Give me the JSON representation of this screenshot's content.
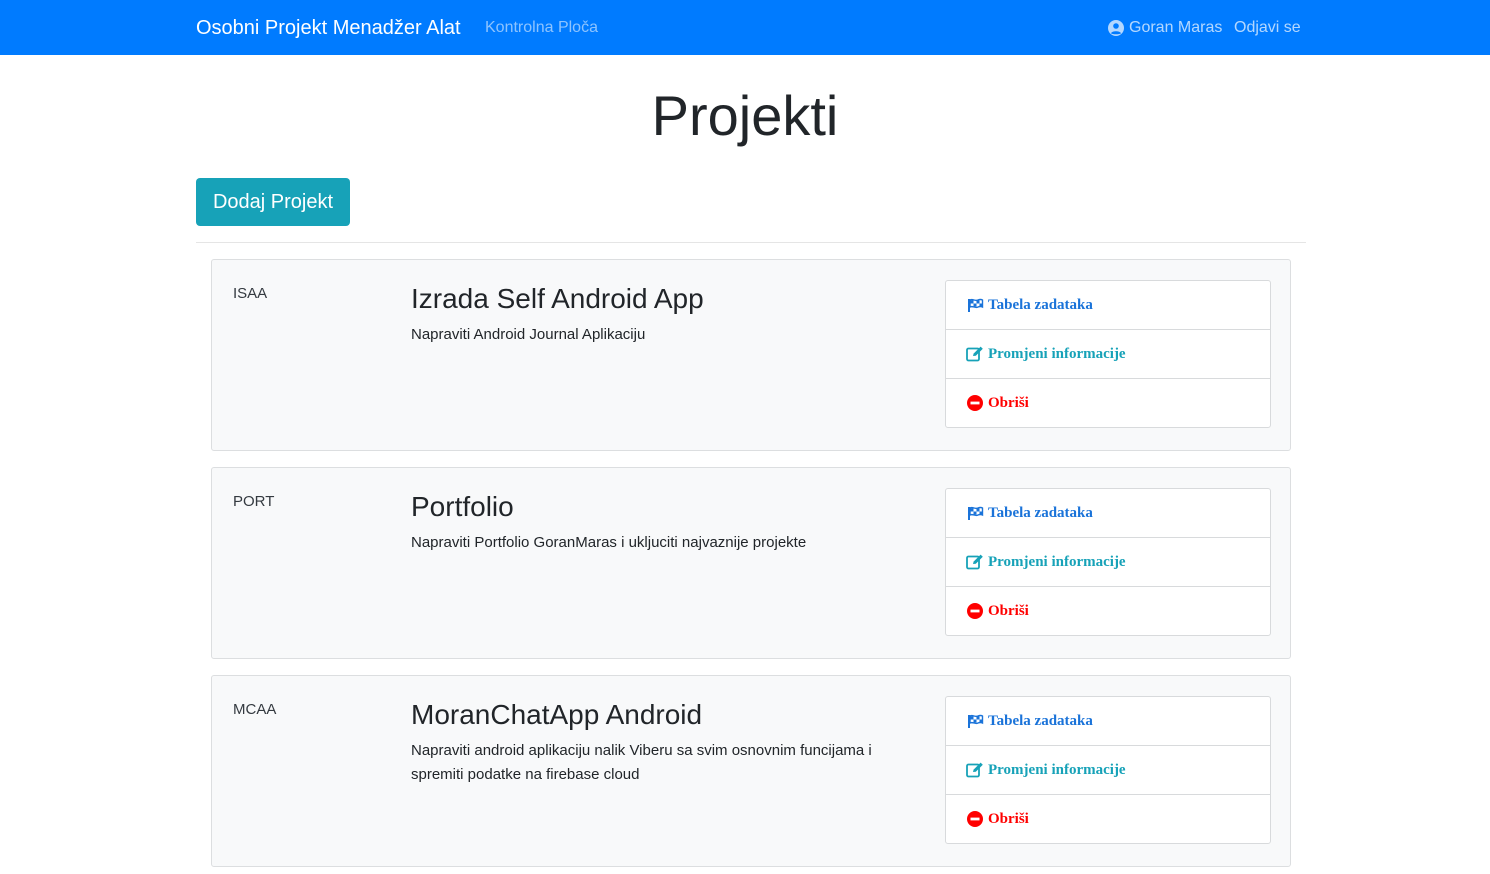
{
  "navbar": {
    "brand": "Osobni Projekt Menadžer Alat",
    "dashboard_link": "Kontrolna Ploča",
    "user_name": "Goran Maras",
    "logout_link": "Odjavi se"
  },
  "page": {
    "title": "Projekti",
    "add_button": "Dodaj Projekt"
  },
  "actions": {
    "tasks": "Tabela zadataka",
    "edit": "Promjeni informacije",
    "delete": "Obriši"
  },
  "projects": [
    {
      "code": "ISAA",
      "name": "Izrada Self Android App",
      "description": "Napraviti Android Journal Aplikaciju"
    },
    {
      "code": "PORT",
      "name": "Portfolio",
      "description": "Napraviti Portfolio GoranMaras i ukljuciti najvaznije projekte"
    },
    {
      "code": "MCAA",
      "name": "MoranChatApp Android",
      "description": "Napraviti android aplikaciju nalik Viberu sa svim osnovnim funcijama i spremiti podatke na firebase cloud"
    }
  ],
  "colors": {
    "navbar": "#007bff",
    "add_button": "#17a2b8",
    "tasks_link": "#1a73d9",
    "edit_link": "#17a2b8",
    "delete_link": "#ff0000"
  },
  "icons": {
    "user": "user-circle-icon",
    "tasks": "flag-checkered-icon",
    "edit": "edit-icon",
    "delete": "minus-circle-icon"
  }
}
